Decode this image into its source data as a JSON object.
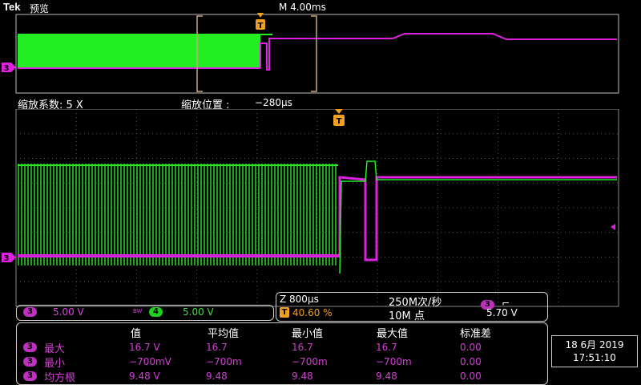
{
  "header": {
    "logo": "Tek",
    "mode": "预览",
    "timebase": "M 4.00ms"
  },
  "zoom_info": {
    "factor_label": "缩放系数: 5 X",
    "position_label": "缩放位置 :",
    "position_value": "−280µs"
  },
  "markers": {
    "trigger": "T",
    "channel": "3"
  },
  "channel_bar": {
    "ch3_badge": "3",
    "ch3_scale": "5.00 V",
    "bw_icon": "BW",
    "ch4_badge": "4",
    "ch4_scale": "5.00 V"
  },
  "acq_panel": {
    "zoom_time": "Z 800µs",
    "sample_rate": "250M次/秒",
    "trigger_pos": "40.60 %",
    "record_length": "10M 点",
    "trig_ch": "3",
    "trig_slope": "⌐",
    "trig_level": "5.70 V"
  },
  "measurements": {
    "headers": [
      "值",
      "平均值",
      "最小值",
      "最大值",
      "标准差"
    ],
    "rows": [
      {
        "ch": "3",
        "name": "最大",
        "values": [
          "16.7 V",
          "16.7",
          "16.7",
          "16.7",
          "0.00"
        ]
      },
      {
        "ch": "3",
        "name": "最小",
        "values": [
          "−700mV",
          "−700m",
          "−700m",
          "−700m",
          "0.00"
        ]
      },
      {
        "ch": "3",
        "name": "均方根",
        "values": [
          "9.48 V",
          "9.48",
          "9.48",
          "9.48",
          "0.00"
        ]
      }
    ]
  },
  "datetime": {
    "date": "18 6月 2019",
    "time": "17:51:10"
  },
  "colors": {
    "ch3": "#e020e0",
    "ch4": "#20f020",
    "trigger": "#f0a020"
  }
}
